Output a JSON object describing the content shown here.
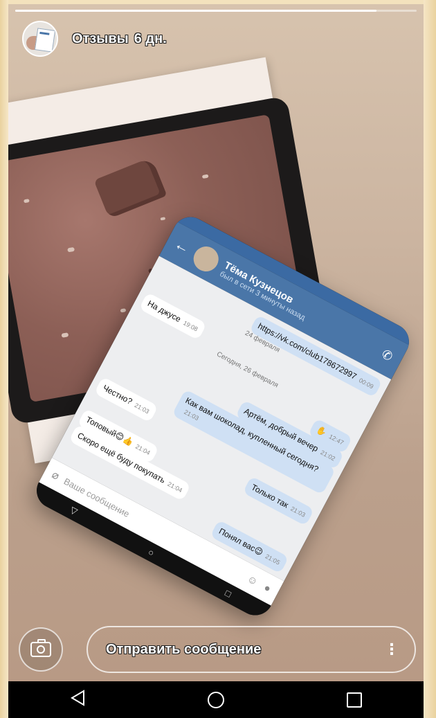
{
  "story": {
    "progress": 0.9,
    "author": "Отзывы",
    "age": "6 дн."
  },
  "vk_chat": {
    "contact_name": "Тёма Кузнецов",
    "contact_status": "был в сети 3 минуты назад",
    "messages": [
      {
        "dir": "out",
        "text": "https://vk.com/club178672997",
        "time": "00:09"
      },
      {
        "type": "date",
        "text": "24 февраля"
      },
      {
        "dir": "in",
        "text": "На джусе",
        "time": "19:08"
      },
      {
        "type": "date",
        "text": "Сегодня, 26 февраля"
      },
      {
        "dir": "out",
        "text": "✋",
        "time": "12:47"
      },
      {
        "dir": "out",
        "text": "Артём, добрый вечер",
        "time": "21:02"
      },
      {
        "dir": "out",
        "text": "Как вам шоколад, купленный сегодня?",
        "time": "21:03"
      },
      {
        "dir": "in",
        "text": "Честно?",
        "time": "21:03"
      },
      {
        "dir": "out",
        "text": "Только так",
        "time": "21:03"
      },
      {
        "dir": "in",
        "text": "Топовый😊👍",
        "time": "21:04"
      },
      {
        "dir": "in",
        "text": "Скоро ещё буду покупать",
        "time": "21:04"
      },
      {
        "dir": "out",
        "text": "Понял вас😉",
        "time": "21:05"
      }
    ],
    "input_placeholder": "Ваше сообщение"
  },
  "reply": {
    "label": "Отправить сообщение"
  },
  "colors": {
    "vk_blue": "#4a76a8",
    "outgoing_bubble": "#cfe0f4"
  },
  "icons": [
    "camera-icon",
    "more-vertical-icon",
    "back-nav-icon",
    "home-nav-icon",
    "recents-nav-icon"
  ]
}
